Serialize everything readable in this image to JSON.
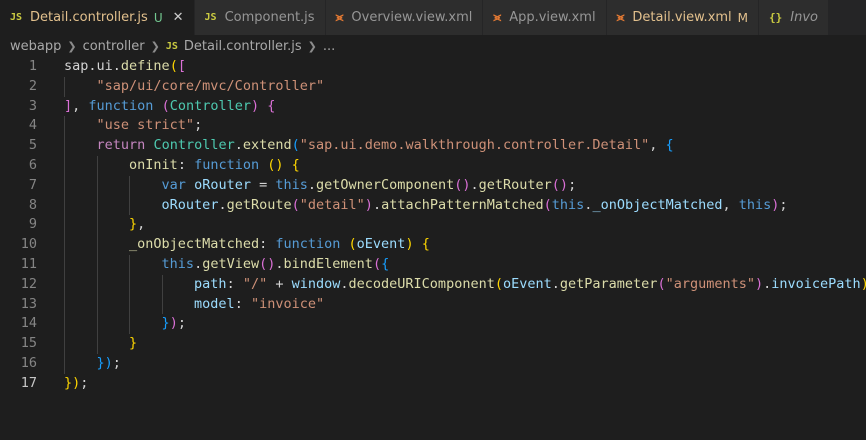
{
  "tabs": [
    {
      "label": "Detail.controller.js",
      "icon": "JS",
      "badge": "U",
      "active": true,
      "close": "✕"
    },
    {
      "label": "Component.js",
      "icon": "JS",
      "badge": "",
      "active": false
    },
    {
      "label": "Overview.view.xml",
      "icon": "xml",
      "badge": "",
      "active": false
    },
    {
      "label": "App.view.xml",
      "icon": "xml",
      "badge": "",
      "active": false
    },
    {
      "label": "Detail.view.xml",
      "icon": "xml",
      "badge": "M",
      "active": false,
      "modified": true
    },
    {
      "label": "Invo",
      "icon": "{}",
      "badge": "",
      "active": false
    }
  ],
  "breadcrumb": {
    "parts": [
      "webapp",
      "controller",
      "Detail.controller.js",
      "..."
    ],
    "file_icon": "JS"
  },
  "editor": {
    "line_numbers": [
      "1",
      "2",
      "3",
      "4",
      "5",
      "6",
      "7",
      "8",
      "9",
      "10",
      "11",
      "12",
      "13",
      "14",
      "15",
      "16",
      "17"
    ],
    "current_line": 17,
    "lines": [
      [
        [
          "pun",
          "sap.ui."
        ],
        [
          "fn",
          "define"
        ],
        [
          "b1",
          "("
        ],
        [
          "b2",
          "["
        ]
      ],
      [
        [
          "pun",
          "    "
        ],
        [
          "str",
          "\"sap/ui/core/mvc/Controller\""
        ]
      ],
      [
        [
          "b2",
          "]"
        ],
        [
          "pun",
          ", "
        ],
        [
          "kw",
          "function"
        ],
        [
          "pun",
          " "
        ],
        [
          "b2",
          "("
        ],
        [
          "cls",
          "Controller"
        ],
        [
          "b2",
          ")"
        ],
        [
          "pun",
          " "
        ],
        [
          "b2",
          "{"
        ]
      ],
      [
        [
          "pun",
          "    "
        ],
        [
          "str",
          "\"use strict\""
        ],
        [
          "pun",
          ";"
        ]
      ],
      [
        [
          "pun",
          "    "
        ],
        [
          "ctl",
          "return"
        ],
        [
          "pun",
          " "
        ],
        [
          "cls",
          "Controller"
        ],
        [
          "pun",
          "."
        ],
        [
          "fn",
          "extend"
        ],
        [
          "b3",
          "("
        ],
        [
          "str",
          "\"sap.ui.demo.walkthrough.controller.Detail\""
        ],
        [
          "pun",
          ", "
        ],
        [
          "b3",
          "{"
        ]
      ],
      [
        [
          "pun",
          "        "
        ],
        [
          "fn",
          "onInit"
        ],
        [
          "pun",
          ": "
        ],
        [
          "kw",
          "function"
        ],
        [
          "pun",
          " "
        ],
        [
          "b1",
          "("
        ],
        [
          "b1",
          ")"
        ],
        [
          "pun",
          " "
        ],
        [
          "b1",
          "{"
        ]
      ],
      [
        [
          "pun",
          "            "
        ],
        [
          "kw",
          "var"
        ],
        [
          "pun",
          " "
        ],
        [
          "var",
          "oRouter"
        ],
        [
          "pun",
          " = "
        ],
        [
          "kw",
          "this"
        ],
        [
          "pun",
          "."
        ],
        [
          "fn",
          "getOwnerComponent"
        ],
        [
          "b2",
          "("
        ],
        [
          "b2",
          ")"
        ],
        [
          "pun",
          "."
        ],
        [
          "fn",
          "getRouter"
        ],
        [
          "b2",
          "("
        ],
        [
          "b2",
          ")"
        ],
        [
          "pun",
          ";"
        ]
      ],
      [
        [
          "pun",
          "            "
        ],
        [
          "var",
          "oRouter"
        ],
        [
          "pun",
          "."
        ],
        [
          "fn",
          "getRoute"
        ],
        [
          "b2",
          "("
        ],
        [
          "str",
          "\"detail\""
        ],
        [
          "b2",
          ")"
        ],
        [
          "pun",
          "."
        ],
        [
          "fn",
          "attachPatternMatched"
        ],
        [
          "b2",
          "("
        ],
        [
          "kw",
          "this"
        ],
        [
          "pun",
          "."
        ],
        [
          "var",
          "_onObjectMatched"
        ],
        [
          "pun",
          ", "
        ],
        [
          "kw",
          "this"
        ],
        [
          "b2",
          ")"
        ],
        [
          "pun",
          ";"
        ]
      ],
      [
        [
          "pun",
          "        "
        ],
        [
          "b1",
          "}"
        ],
        [
          "pun",
          ","
        ]
      ],
      [
        [
          "pun",
          "        "
        ],
        [
          "fn",
          "_onObjectMatched"
        ],
        [
          "pun",
          ": "
        ],
        [
          "kw",
          "function"
        ],
        [
          "pun",
          " "
        ],
        [
          "b1",
          "("
        ],
        [
          "var",
          "oEvent"
        ],
        [
          "b1",
          ")"
        ],
        [
          "pun",
          " "
        ],
        [
          "b1",
          "{"
        ]
      ],
      [
        [
          "pun",
          "            "
        ],
        [
          "kw",
          "this"
        ],
        [
          "pun",
          "."
        ],
        [
          "fn",
          "getView"
        ],
        [
          "b2",
          "("
        ],
        [
          "b2",
          ")"
        ],
        [
          "pun",
          "."
        ],
        [
          "fn",
          "bindElement"
        ],
        [
          "b2",
          "("
        ],
        [
          "b3",
          "{"
        ]
      ],
      [
        [
          "pun",
          "                "
        ],
        [
          "var",
          "path"
        ],
        [
          "pun",
          ": "
        ],
        [
          "str",
          "\"/\""
        ],
        [
          "pun",
          " + "
        ],
        [
          "var",
          "window"
        ],
        [
          "pun",
          "."
        ],
        [
          "fn",
          "decodeURIComponent"
        ],
        [
          "b1",
          "("
        ],
        [
          "var",
          "oEvent"
        ],
        [
          "pun",
          "."
        ],
        [
          "fn",
          "getParameter"
        ],
        [
          "b2",
          "("
        ],
        [
          "str",
          "\"arguments\""
        ],
        [
          "b2",
          ")"
        ],
        [
          "pun",
          "."
        ],
        [
          "var",
          "invoicePath"
        ],
        [
          "b1",
          ")"
        ],
        [
          "pun",
          ","
        ]
      ],
      [
        [
          "pun",
          "                "
        ],
        [
          "var",
          "model"
        ],
        [
          "pun",
          ": "
        ],
        [
          "str",
          "\"invoice\""
        ]
      ],
      [
        [
          "pun",
          "            "
        ],
        [
          "b3",
          "}"
        ],
        [
          "b2",
          ")"
        ],
        [
          "pun",
          ";"
        ]
      ],
      [
        [
          "pun",
          "        "
        ],
        [
          "b1",
          "}"
        ]
      ],
      [
        [
          "pun",
          "    "
        ],
        [
          "b3",
          "}"
        ],
        [
          "b3",
          ")"
        ],
        [
          "pun",
          ";"
        ]
      ],
      [
        [
          "b1",
          "}"
        ],
        [
          "b1",
          ")"
        ],
        [
          "pun",
          ";"
        ]
      ]
    ]
  },
  "colors": {
    "background": "#1e1e1e",
    "tabbar": "#252526",
    "keyword": "#569cd6",
    "string": "#ce9178",
    "function": "#dcdcaa",
    "variable": "#9cdcfe",
    "class": "#4ec9b0",
    "control": "#c586c0"
  }
}
